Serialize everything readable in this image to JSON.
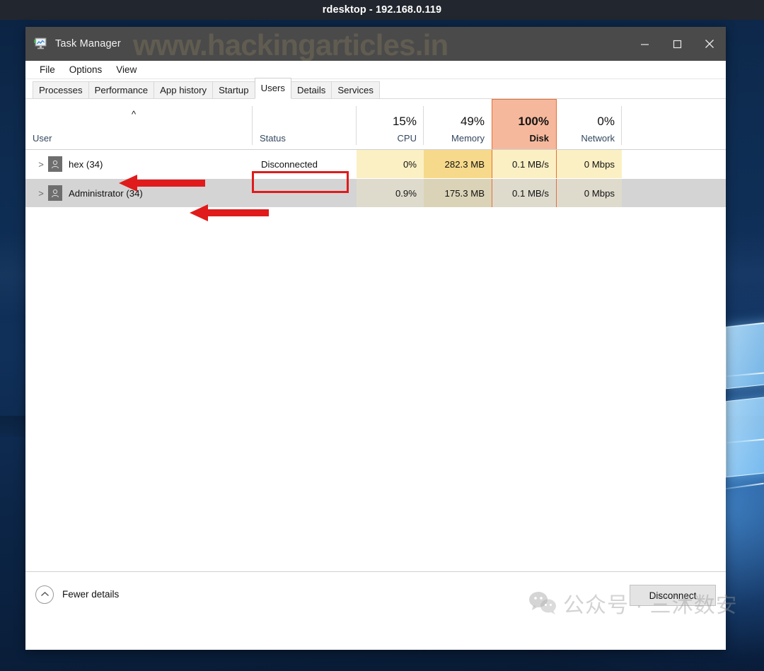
{
  "rdesktop": {
    "title": "rdesktop - 192.168.0.119"
  },
  "taskmanager": {
    "title": "Task Manager",
    "icon": "task-manager-monitor-icon",
    "watermark_top": "www.hackingarticles.in",
    "window_controls": {
      "minimize": "minimize-icon",
      "maximize": "maximize-icon",
      "close": "close-icon"
    },
    "menu": [
      {
        "label": "File"
      },
      {
        "label": "Options"
      },
      {
        "label": "View"
      }
    ],
    "tabs": [
      {
        "label": "Processes",
        "selected": false
      },
      {
        "label": "Performance",
        "selected": false
      },
      {
        "label": "App history",
        "selected": false
      },
      {
        "label": "Startup",
        "selected": false
      },
      {
        "label": "Users",
        "selected": true
      },
      {
        "label": "Details",
        "selected": false
      },
      {
        "label": "Services",
        "selected": false
      }
    ],
    "table": {
      "sort_indicator": "^",
      "sort_column": "User",
      "sort_direction": "ascending",
      "columns": [
        {
          "key": "user",
          "label": "User",
          "pct": "",
          "highlighted": false
        },
        {
          "key": "status",
          "label": "Status",
          "pct": "",
          "highlighted": false
        },
        {
          "key": "cpu",
          "label": "CPU",
          "pct": "15%",
          "highlighted": false
        },
        {
          "key": "memory",
          "label": "Memory",
          "pct": "49%",
          "highlighted": false
        },
        {
          "key": "disk",
          "label": "Disk",
          "pct": "100%",
          "highlighted": true
        },
        {
          "key": "network",
          "label": "Network",
          "pct": "0%",
          "highlighted": false
        }
      ],
      "rows": [
        {
          "expander": ">",
          "avatar": "user-avatar-icon",
          "user": "hex (34)",
          "status": "Disconnected",
          "cpu": "0%",
          "memory": "282.3 MB",
          "disk": "0.1 MB/s",
          "network": "0 Mbps",
          "selected": false
        },
        {
          "expander": ">",
          "avatar": "user-avatar-icon",
          "user": "Administrator (34)",
          "status": "",
          "cpu": "0.9%",
          "memory": "175.3 MB",
          "disk": "0.1 MB/s",
          "network": "0 Mbps",
          "selected": true
        }
      ]
    },
    "footer": {
      "fewer_details_label": "Fewer details",
      "fewer_details_icon": "chevron-up-circle-icon",
      "disconnect_label": "Disconnect"
    },
    "watermark_bottom": {
      "icon": "wechat-icon",
      "text": "公众号 · 三沐数安"
    }
  },
  "colors": {
    "accent_orange": "#e2703a",
    "disk_header_bg": "#f6b898",
    "annotation_red": "#e01b1b",
    "heat_yellow": "#fbf0c4",
    "heat_yellow_strong": "#f6d98b",
    "selected_row": "#d4d4d4",
    "titlebar": "#4a4a4a"
  }
}
